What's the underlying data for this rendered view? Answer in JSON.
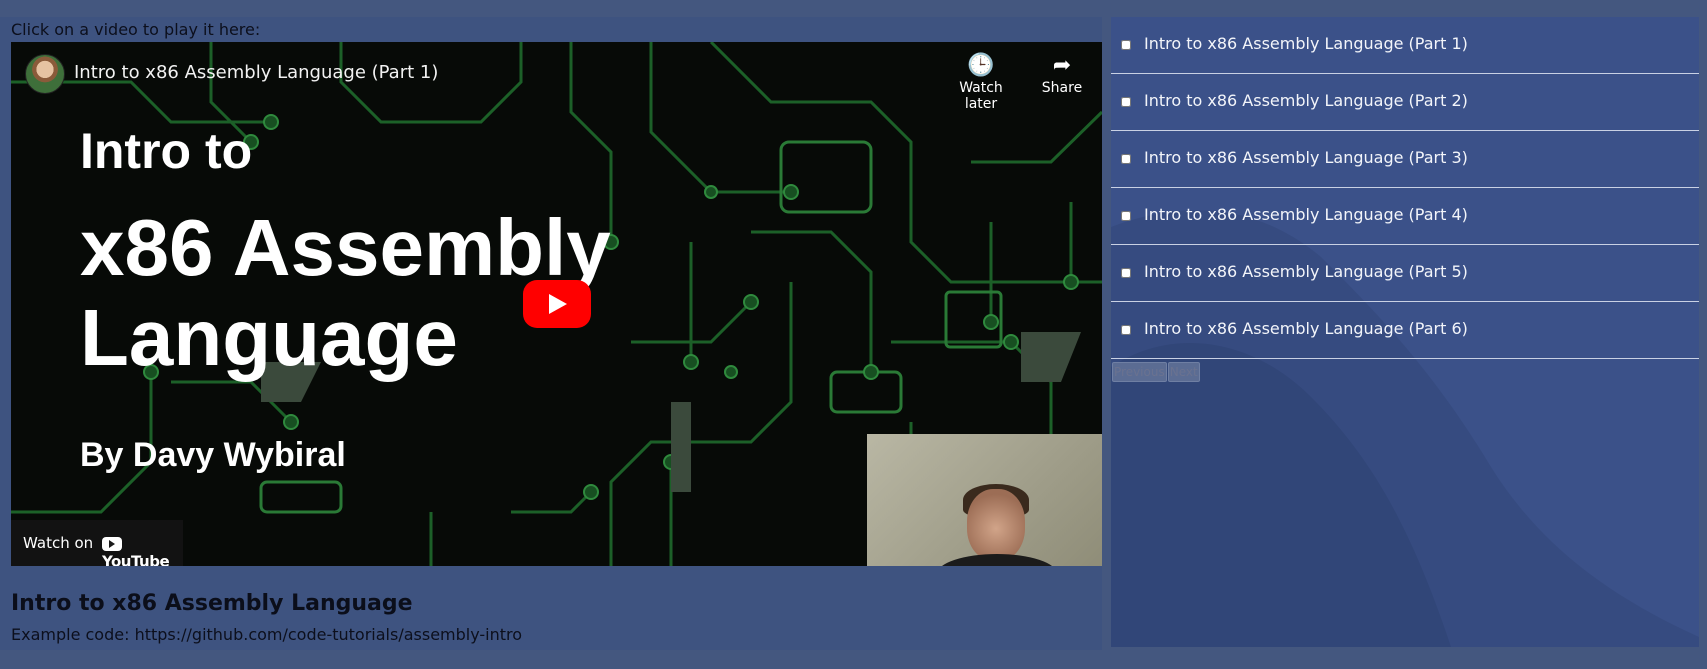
{
  "instruction": "Click on a video to play it here:",
  "player": {
    "video_title": "Intro to x86 Assembly Language (Part 1)",
    "watch_later_label": "Watch later",
    "share_label": "Share",
    "thumbnail": {
      "line1": "Intro to",
      "line2": "x86 Assembly",
      "line3": "Language",
      "byline": "By Davy Wybiral"
    },
    "watch_on_label": "Watch on",
    "youtube_word": "YouTube",
    "icons": [
      "clock-icon",
      "share-arrow-icon",
      "play-icon",
      "youtube-logo-icon"
    ]
  },
  "video_heading": "Intro to x86 Assembly Language",
  "video_description": "Example code: https://github.com/code-tutorials/assembly-intro",
  "playlist": {
    "items": [
      {
        "label": "Intro to x86 Assembly Language (Part 1)",
        "checked": false
      },
      {
        "label": "Intro to x86 Assembly Language (Part 2)",
        "checked": false
      },
      {
        "label": "Intro to x86 Assembly Language (Part 3)",
        "checked": false
      },
      {
        "label": "Intro to x86 Assembly Language (Part 4)",
        "checked": false
      },
      {
        "label": "Intro to x86 Assembly Language (Part 5)",
        "checked": false
      },
      {
        "label": "Intro to x86 Assembly Language (Part 6)",
        "checked": false
      }
    ]
  },
  "pager": {
    "previous_label": "Previous",
    "next_label": "Next"
  },
  "colors": {
    "page_bg": "#44577f",
    "left_panel_bg": "#3e5380",
    "right_panel_bg": "#3b5189",
    "play_button": "#ff0000",
    "circuit_green": "#1f6a2c"
  }
}
